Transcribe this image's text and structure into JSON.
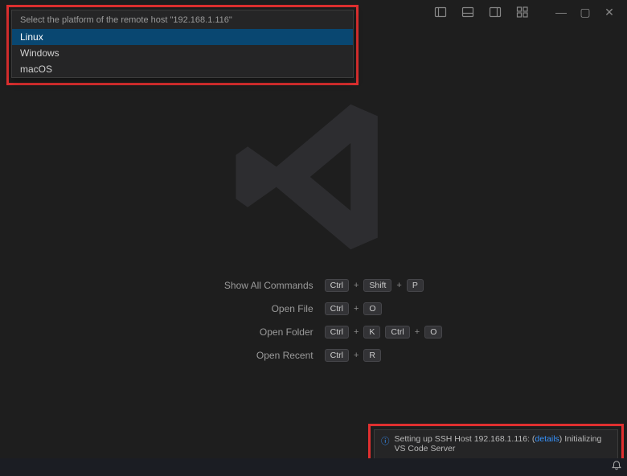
{
  "quick_pick": {
    "prompt": "Select the platform of the remote host \"192.168.1.116\"",
    "items": [
      "Linux",
      "Windows",
      "macOS"
    ],
    "selected_index": 0
  },
  "welcome": {
    "shortcuts": {
      "show_all_commands": {
        "label": "Show All Commands",
        "keys": [
          "Ctrl",
          "+",
          "Shift",
          "+",
          "P"
        ]
      },
      "open_file": {
        "label": "Open File",
        "keys": [
          "Ctrl",
          "+",
          "O"
        ]
      },
      "open_folder": {
        "label": "Open Folder",
        "keys": [
          "Ctrl",
          "+",
          "K",
          "Ctrl",
          "+",
          "O"
        ]
      },
      "open_recent": {
        "label": "Open Recent",
        "keys": [
          "Ctrl",
          "+",
          "R"
        ]
      }
    }
  },
  "notification": {
    "message_a": "Setting up SSH Host 192.168.1.116: (",
    "details_label": "details",
    "message_b": ") Initializing VS Code Server"
  },
  "window_controls": {
    "minimize": "—",
    "maximize": "▢",
    "close": "✕"
  }
}
